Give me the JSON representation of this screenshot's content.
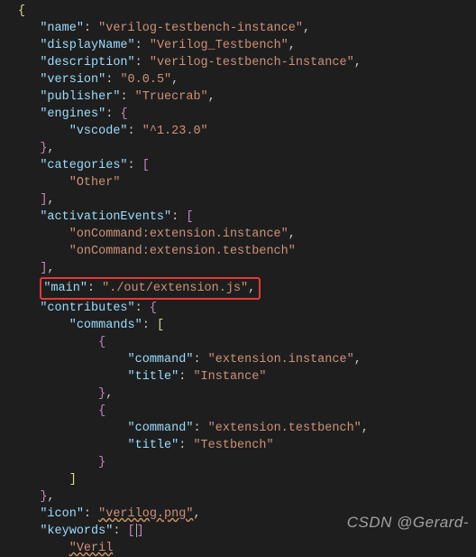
{
  "json": {
    "name_key": "\"name\"",
    "name_val": "\"verilog-testbench-instance\"",
    "displayName_key": "\"displayName\"",
    "displayName_val": "\"Verilog_Testbench\"",
    "description_key": "\"description\"",
    "description_val": "\"verilog-testbench-instance\"",
    "version_key": "\"version\"",
    "version_val": "\"0.0.5\"",
    "publisher_key": "\"publisher\"",
    "publisher_val": "\"Truecrab\"",
    "engines_key": "\"engines\"",
    "vscode_key": "\"vscode\"",
    "vscode_val": "\"^1.23.0\"",
    "categories_key": "\"categories\"",
    "category0_val": "\"Other\"",
    "activationEvents_key": "\"activationEvents\"",
    "activation0_val": "\"onCommand:extension.instance\"",
    "activation1_val": "\"onCommand:extension.testbench\"",
    "main_key": "\"main\"",
    "main_val": "\"./out/extension.js\"",
    "contributes_key": "\"contributes\"",
    "commands_key": "\"commands\"",
    "command_key": "\"command\"",
    "title_key": "\"title\"",
    "cmd0_command_val": "\"extension.instance\"",
    "cmd0_title_val": "\"Instance\"",
    "cmd1_command_val": "\"extension.testbench\"",
    "cmd1_title_val": "\"Testbench\"",
    "icon_key": "\"icon\"",
    "icon_val": "\"verilog.png\"",
    "keywords_key": "\"keywords\"",
    "cut_key": "\"Veril"
  },
  "watermark": "CSDN @Gerard-"
}
